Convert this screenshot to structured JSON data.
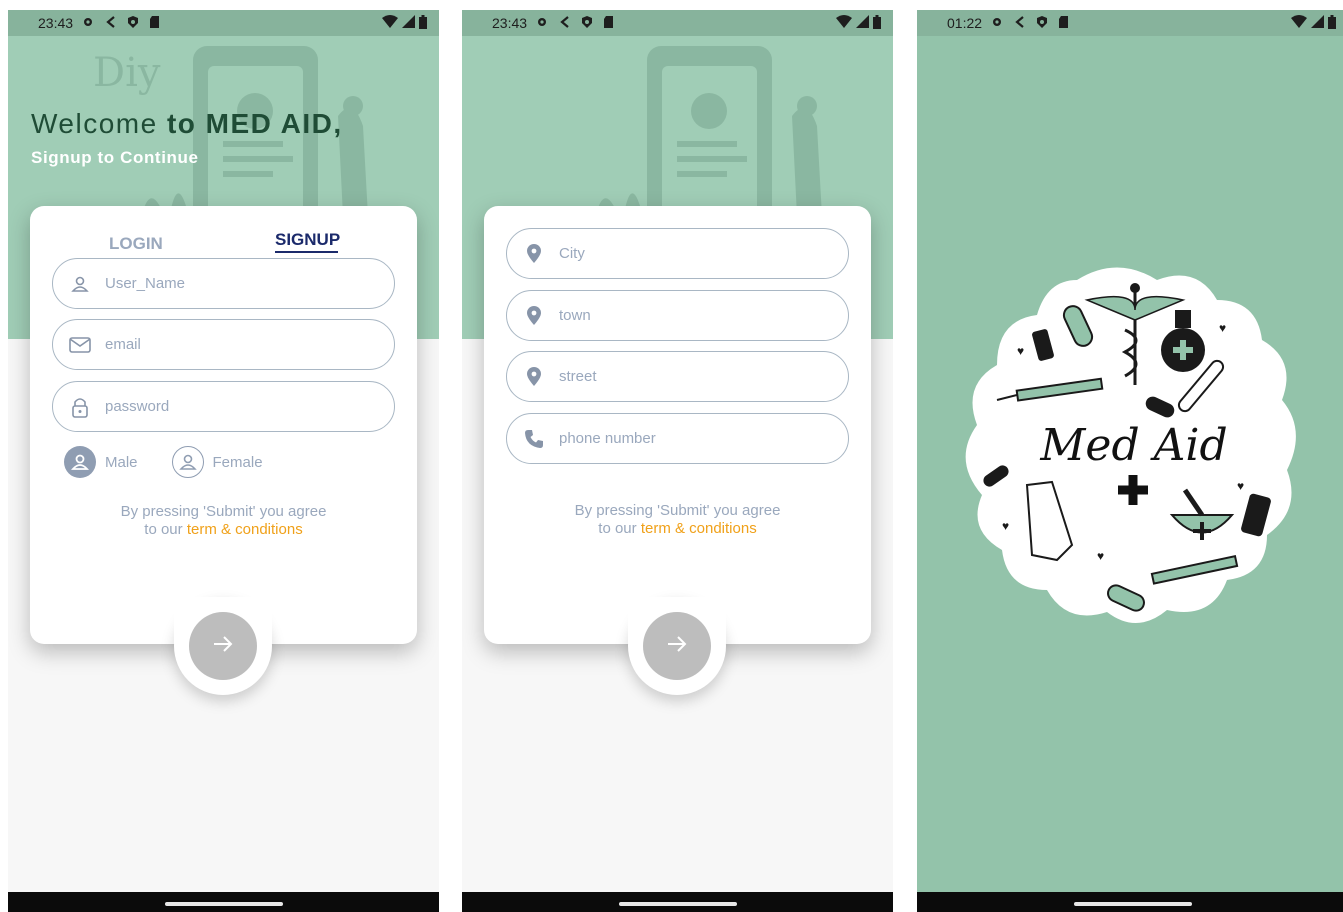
{
  "screens": [
    {
      "status": {
        "time": "23:43"
      },
      "welcome": {
        "part1": "Welcome ",
        "part2": "to MED AID,",
        "subtitle": "Signup to Continue"
      },
      "tabs": {
        "login": "LOGIN",
        "signup": "SIGNUP"
      },
      "fields": [
        {
          "placeholder": "User_Name",
          "icon": "person-icon"
        },
        {
          "placeholder": "email",
          "icon": "mail-icon"
        },
        {
          "placeholder": "password",
          "icon": "lock-icon"
        }
      ],
      "gender": {
        "male": "Male",
        "female": "Female",
        "selected": "Male"
      },
      "agree": {
        "line1": "By pressing 'Submit' you agree",
        "line2_prefix": "to our ",
        "link": "term & conditions"
      },
      "submit_icon": "arrow-right-icon"
    },
    {
      "status": {
        "time": "23:43"
      },
      "fields": [
        {
          "placeholder": "City",
          "icon": "location-pin-icon"
        },
        {
          "placeholder": "town",
          "icon": "location-pin-icon"
        },
        {
          "placeholder": "street",
          "icon": "location-pin-icon"
        },
        {
          "placeholder": "phone number",
          "icon": "phone-icon"
        }
      ],
      "agree": {
        "line1": "By pressing 'Submit' you agree",
        "line2_prefix": "to our ",
        "link": "term & conditions"
      },
      "submit_icon": "arrow-right-icon"
    },
    {
      "status": {
        "time": "01:22"
      },
      "logo_text": "Med Aid"
    }
  ],
  "colors": {
    "accent": "#a0cdb6",
    "dark_green": "#1f4c36",
    "link": "#f0a11a",
    "tab_active": "#1b2a6b",
    "muted": "#9aa8bd"
  }
}
